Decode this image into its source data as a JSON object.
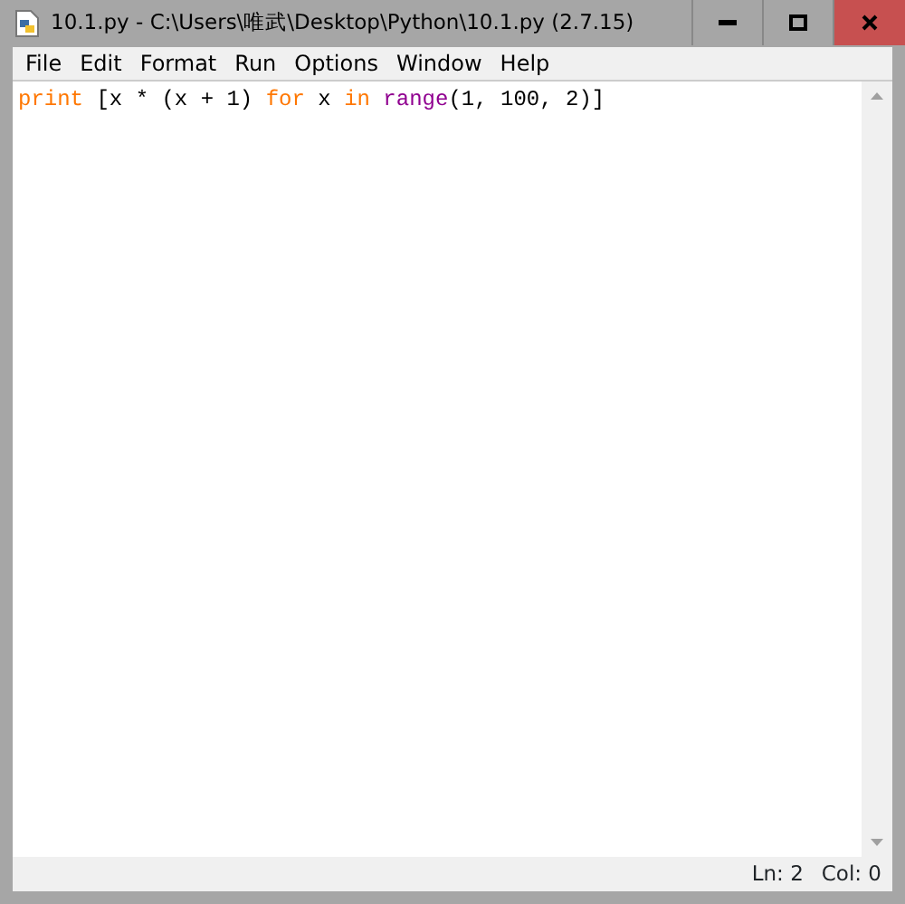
{
  "window": {
    "title": "10.1.py - C:\\Users\\唯武\\Desktop\\Python\\10.1.py (2.7.15)"
  },
  "menu": [
    "File",
    "Edit",
    "Format",
    "Run",
    "Options",
    "Window",
    "Help"
  ],
  "code": [
    {
      "kind": "keyword",
      "text": "print"
    },
    {
      "kind": "plain",
      "text": " [x * (x + 1) "
    },
    {
      "kind": "keyword",
      "text": "for"
    },
    {
      "kind": "plain",
      "text": " x "
    },
    {
      "kind": "keyword",
      "text": "in "
    },
    {
      "kind": "builtin",
      "text": "range"
    },
    {
      "kind": "plain",
      "text": "(1, 100, 2)]"
    }
  ],
  "status_bar": [
    "Ln: 2",
    "Col: 0"
  ]
}
